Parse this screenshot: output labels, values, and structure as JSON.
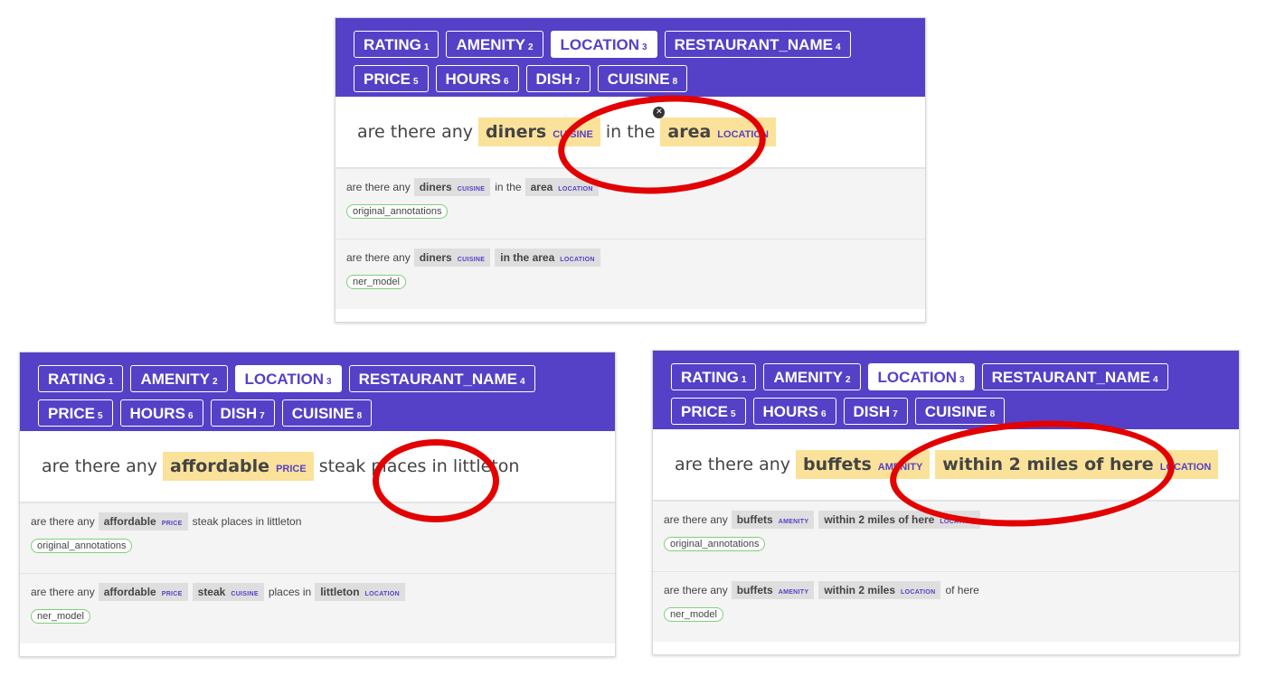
{
  "labels": [
    [
      {
        "name": "RATING",
        "num": "1"
      },
      {
        "name": "AMENITY",
        "num": "2"
      },
      {
        "name": "LOCATION",
        "num": "3",
        "active": true
      },
      {
        "name": "RESTAURANT_NAME",
        "num": "4"
      }
    ],
    [
      {
        "name": "PRICE",
        "num": "5"
      },
      {
        "name": "HOURS",
        "num": "6"
      },
      {
        "name": "DISH",
        "num": "7"
      },
      {
        "name": "CUISINE",
        "num": "8"
      }
    ]
  ],
  "panels": [
    {
      "main": [
        {
          "text": "are there any"
        },
        {
          "text": "diners",
          "label": "CUISINE"
        },
        {
          "text": "in the"
        },
        {
          "text": "area",
          "label": "LOCATION",
          "close": true
        }
      ],
      "predictions": [
        {
          "tokens": [
            {
              "text": "are there any"
            },
            {
              "text": "diners",
              "label": "CUISINE"
            },
            {
              "text": "in the"
            },
            {
              "text": "area",
              "label": "LOCATION"
            }
          ],
          "source": "original_annotations"
        },
        {
          "tokens": [
            {
              "text": "are there any"
            },
            {
              "text": "diners",
              "label": "CUISINE"
            },
            {
              "text": "in the area",
              "label": "LOCATION"
            }
          ],
          "source": "ner_model"
        }
      ]
    },
    {
      "main": [
        {
          "text": "are there any"
        },
        {
          "text": "affordable",
          "label": "PRICE"
        },
        {
          "text": "steak places in littleton"
        }
      ],
      "predictions": [
        {
          "tokens": [
            {
              "text": "are there any"
            },
            {
              "text": "affordable",
              "label": "PRICE"
            },
            {
              "text": "steak places in littleton"
            }
          ],
          "source": "original_annotations"
        },
        {
          "tokens": [
            {
              "text": "are there any"
            },
            {
              "text": "affordable",
              "label": "PRICE"
            },
            {
              "text": "steak",
              "label": "CUISINE"
            },
            {
              "text": "places in"
            },
            {
              "text": "littleton",
              "label": "LOCATION"
            }
          ],
          "source": "ner_model"
        }
      ]
    },
    {
      "main": [
        {
          "text": "are there any"
        },
        {
          "text": "buffets",
          "label": "AMENITY"
        },
        {
          "text": "within 2 miles of here",
          "label": "LOCATION"
        }
      ],
      "predictions": [
        {
          "tokens": [
            {
              "text": "are there any"
            },
            {
              "text": "buffets",
              "label": "AMENITY"
            },
            {
              "text": "within 2 miles of here",
              "label": "LOCATION"
            }
          ],
          "source": "original_annotations"
        },
        {
          "tokens": [
            {
              "text": "are there any"
            },
            {
              "text": "buffets",
              "label": "AMENITY"
            },
            {
              "text": "within 2 miles",
              "label": "LOCATION"
            },
            {
              "text": "of here"
            }
          ],
          "source": "ner_model"
        }
      ]
    }
  ],
  "colors": {
    "header": "#5541c7",
    "entity": "#fbe29a",
    "highlight_circle": "#e30000",
    "source_border": "#7ed07a"
  }
}
